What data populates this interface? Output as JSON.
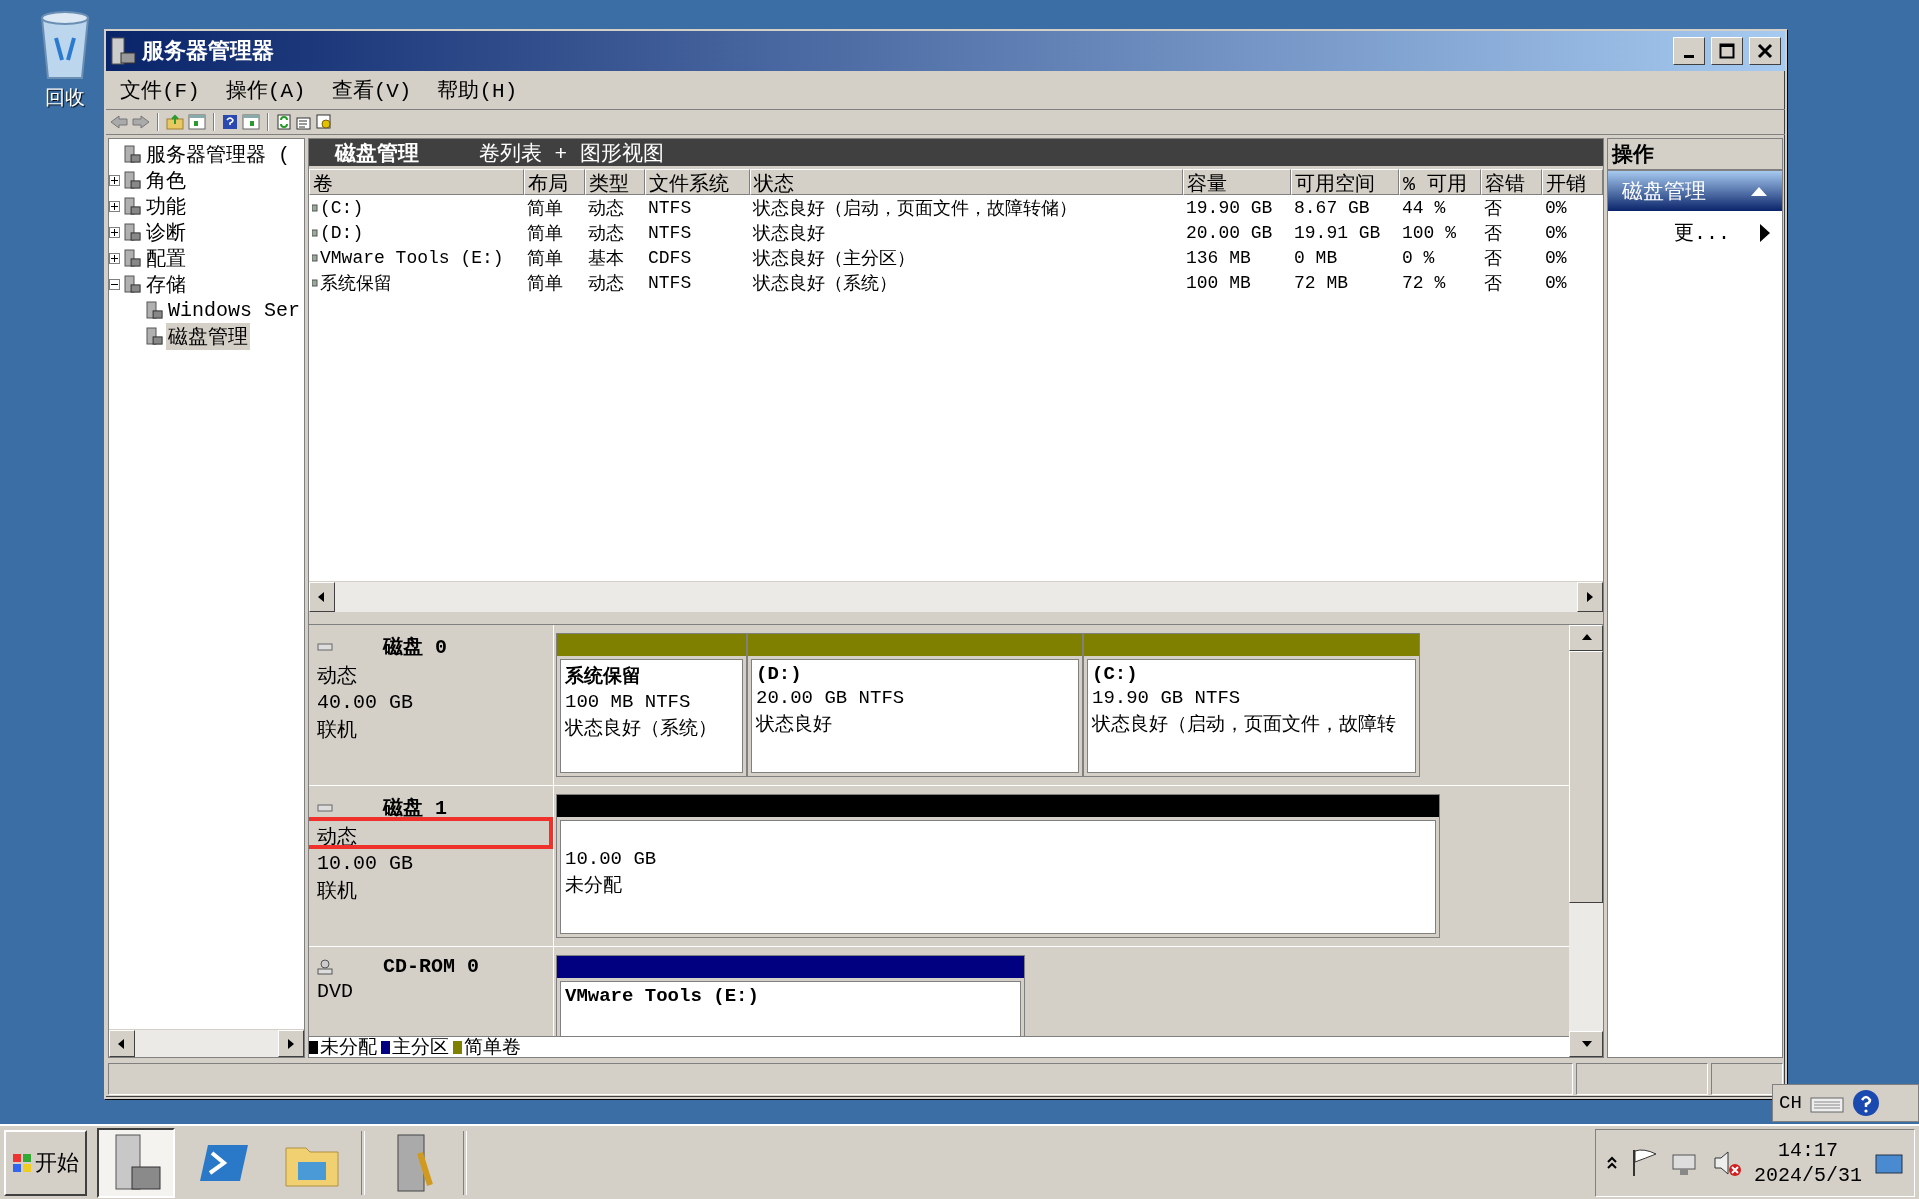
{
  "desktop": {
    "icons": [
      {
        "label": "回收"
      }
    ]
  },
  "window": {
    "title": "服务器管理器",
    "menu": [
      "文件(F)",
      "操作(A)",
      "查看(V)",
      "帮助(H)"
    ]
  },
  "tree": [
    {
      "label": "服务器管理器 (",
      "selected": false,
      "children": [
        {
          "label": "角色",
          "expanded": false,
          "selected": false
        },
        {
          "label": "功能",
          "expanded": false,
          "selected": false
        },
        {
          "label": "诊断",
          "expanded": false,
          "selected": false
        },
        {
          "label": "配置",
          "expanded": false,
          "selected": false
        },
        {
          "label": "存储",
          "expanded": true,
          "selected": false,
          "children": [
            {
              "label": "Windows Ser",
              "selected": false
            },
            {
              "label": "磁盘管理",
              "selected": true
            }
          ]
        }
      ]
    }
  ],
  "content": {
    "title": "磁盘管理",
    "view": "卷列表 + 图形视图"
  },
  "table": {
    "columns": [
      "卷",
      "布局",
      "类型",
      "文件系统",
      "状态",
      "容量",
      "可用空间",
      "% 可用",
      "容错",
      "开销"
    ],
    "rows": [
      [
        "(C:)",
        "简单",
        "动态",
        "NTFS",
        "状态良好（启动，页面文件，故障转储）",
        "19.90 GB",
        "8.67 GB",
        "44 %",
        "否",
        "0%"
      ],
      [
        "(D:)",
        "简单",
        "动态",
        "NTFS",
        "状态良好",
        "20.00 GB",
        "19.91 GB",
        "100 %",
        "否",
        "0%"
      ],
      [
        "VMware Tools (E:)",
        "简单",
        "基本",
        "CDFS",
        "状态良好（主分区）",
        "136 MB",
        "0 MB",
        "0 %",
        "否",
        "0%"
      ],
      [
        "系统保留",
        "简单",
        "动态",
        "NTFS",
        "状态良好（系统）",
        "100 MB",
        "72 MB",
        "72 %",
        "否",
        "0%"
      ]
    ]
  },
  "disks": [
    {
      "kind": "hdd",
      "name": "磁盘 0",
      "type": "动态",
      "size": "40.00 GB",
      "status": "联机",
      "highlighted": false,
      "partitions": [
        {
          "kind": "simple",
          "name": "系统保留",
          "size": "100 MB NTFS",
          "status": "状态良好（系统）"
        },
        {
          "kind": "simple",
          "name": "(D:)",
          "size": "20.00 GB NTFS",
          "status": "状态良好"
        },
        {
          "kind": "simple",
          "name": "(C:)",
          "size": "19.90 GB NTFS",
          "status": "状态良好（启动，页面文件，故障转"
        }
      ]
    },
    {
      "kind": "hdd",
      "name": "磁盘 1",
      "type": "动态",
      "size": "10.00 GB",
      "status": "联机",
      "highlighted": true,
      "partitions": [
        {
          "kind": "unallocated",
          "size": "10.00 GB",
          "status": "未分配"
        }
      ]
    },
    {
      "kind": "cdrom",
      "name": "CD-ROM 0",
      "type": "DVD",
      "highlighted": false,
      "partitions": [
        {
          "kind": "primary",
          "name": "VMware Tools (E:)"
        }
      ]
    }
  ],
  "legend": [
    {
      "label": "未分配",
      "color": "#000000"
    },
    {
      "label": "主分区",
      "color": "#000080"
    },
    {
      "label": "简单卷",
      "color": "#808000"
    }
  ],
  "actions": {
    "title": "操作",
    "section": "磁盘管理",
    "items": [
      "更..."
    ]
  },
  "language_bar": {
    "language": "CH"
  },
  "taskbar": {
    "start": "开始",
    "time": "14:17",
    "date": "2024/5/31"
  }
}
